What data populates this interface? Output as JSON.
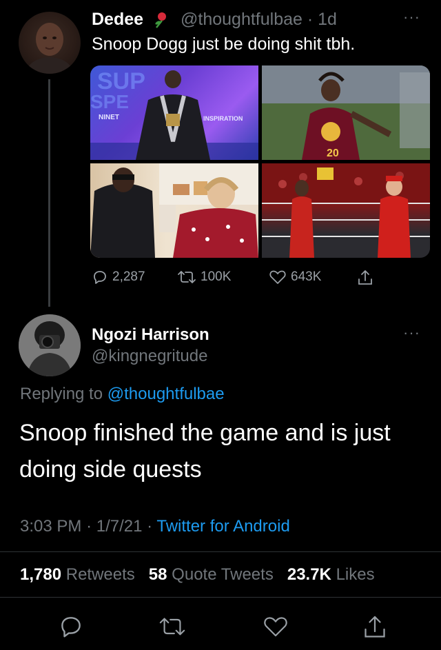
{
  "original_tweet": {
    "author_name": "Dedee",
    "emoji_icon": "rose-emoji",
    "handle": "@thoughtfulbae",
    "separator": "·",
    "age": "1d",
    "text": "Snoop Dogg just be doing shit tbh.",
    "more_label": "···",
    "media": [
      {
        "icon": "photo-snoop-dogg-stage",
        "overlay_text_1": "SUP",
        "overlay_text_2": "SPE",
        "overlay_text_3": "NINET",
        "overlay_text_4": "INSPIRATION"
      },
      {
        "icon": "photo-snoop-dogg-football",
        "jersey_number": "20"
      },
      {
        "icon": "photo-snoop-dogg-cooking-show"
      },
      {
        "icon": "photo-snoop-dogg-wrestling-ring"
      }
    ],
    "reply_count": "2,287",
    "retweet_count": "100K",
    "like_count": "643K"
  },
  "reply_tweet": {
    "author_name": "Ngozi Harrison",
    "handle": "@kingnegritude",
    "more_label": "···",
    "replying_prefix": "Replying to",
    "replying_handle": "@thoughtfulbae",
    "text": "Snoop finished the game and is just doing side quests",
    "time": "3:03 PM",
    "date": "1/7/21",
    "separator": "·",
    "source": "Twitter for Android",
    "stats": {
      "retweets_value": "1,780",
      "retweets_label": "Retweets",
      "quotes_value": "58",
      "quotes_label": "Quote Tweets",
      "likes_value": "23.7K",
      "likes_label": "Likes"
    }
  },
  "colors": {
    "background": "#000000",
    "text": "#e7e9ea",
    "muted": "#71767b",
    "link": "#1d9bf0",
    "divider": "#2f3336"
  }
}
